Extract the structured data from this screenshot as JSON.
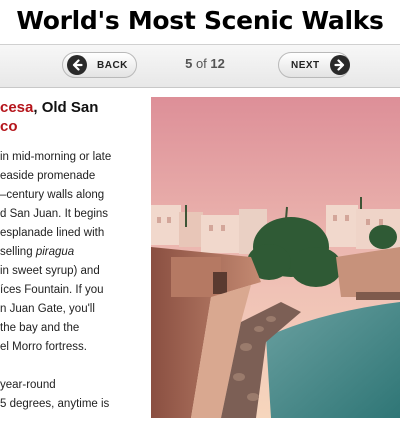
{
  "page": {
    "title": "World's Most Scenic Walks"
  },
  "nav": {
    "back_label": "BACK",
    "next_label": "NEXT",
    "current": "5",
    "of_text": "of",
    "total": "12"
  },
  "article": {
    "headline_red": "cesa",
    "headline_rest": ", Old San",
    "headline_line2": "co",
    "lines": [
      " in mid-morning or late",
      "easide promenade",
      "–century walls along",
      "d San Juan. It begins",
      "esplanade lined with",
      " selling ",
      "in sweet syrup) and",
      "íces Fountain. If you",
      "n Juan Gate, you'll",
      " the bay and the",
      "el Morro fortress."
    ],
    "italic_word": "piragua",
    "para2_lines": [
      "year-round",
      "5 degrees, anytime is"
    ]
  },
  "photo": {
    "description_icon": "scenic-photo",
    "colors": {
      "sky_top": "#e6a0a6",
      "sky_bottom": "#f3cbb6",
      "water": "#3e8585",
      "wall": "#b06f5a"
    }
  }
}
